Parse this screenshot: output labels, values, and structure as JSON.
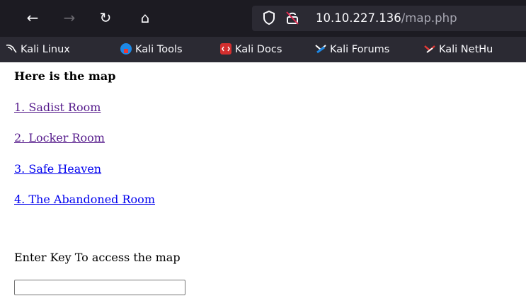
{
  "browser": {
    "nav": {
      "back": "←",
      "forward": "→",
      "reload": "↻",
      "home": "⌂"
    },
    "address": {
      "host": "10.10.227.136",
      "path": "/map.php",
      "shield_icon": "shield-icon",
      "insecure_icon": "insecure-lock-icon"
    },
    "bookmarks": [
      {
        "label": "Kali Linux",
        "icon": "kali-dragon-icon"
      },
      {
        "label": "Kali Tools",
        "icon": "kali-tools-icon"
      },
      {
        "label": "Kali Docs",
        "icon": "kali-docs-icon"
      },
      {
        "label": "Kali Forums",
        "icon": "kali-forums-icon"
      },
      {
        "label": "Kali NetHu",
        "icon": "kali-nethunter-icon"
      }
    ]
  },
  "page": {
    "heading": "Here is the map",
    "links": [
      {
        "label": "1. Sadist Room",
        "visited": true
      },
      {
        "label": "2. Locker Room",
        "visited": true
      },
      {
        "label": "3. Safe Heaven",
        "visited": false
      },
      {
        "label": "4. The Abandoned Room",
        "visited": false
      }
    ],
    "key_prompt": "Enter Key To access the map",
    "key_input_value": ""
  },
  "colors": {
    "toolbar_bg": "#1c1b22",
    "urlbar_bg": "#2b2a33",
    "bookmarks_bg": "#2b2a33",
    "visited_link": "#551a8b",
    "unvisited_link": "#0000ee"
  }
}
